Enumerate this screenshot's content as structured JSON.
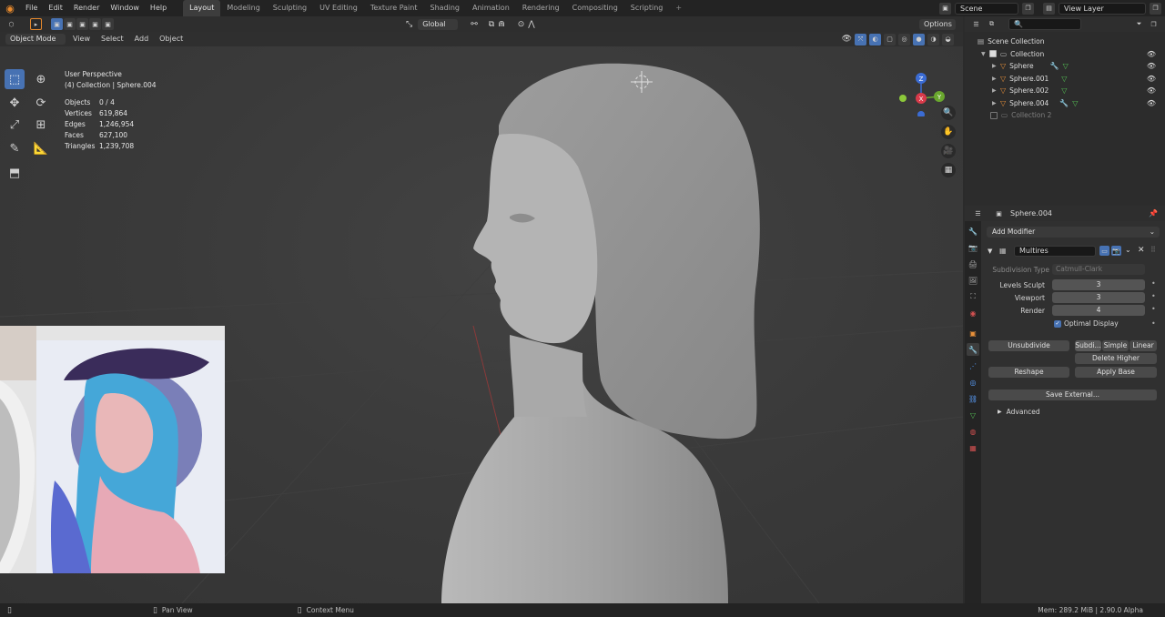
{
  "menu": [
    "File",
    "Edit",
    "Render",
    "Window",
    "Help"
  ],
  "workspaces": [
    "Layout",
    "Modeling",
    "Sculpting",
    "UV Editing",
    "Texture Paint",
    "Shading",
    "Animation",
    "Rendering",
    "Compositing",
    "Scripting"
  ],
  "workspace_active": "Layout",
  "scene": "Scene",
  "view_layer": "View Layer",
  "viewport": {
    "options": "Options",
    "orientation": "Global",
    "mode": "Object Mode",
    "menus": [
      "View",
      "Select",
      "Add",
      "Object"
    ],
    "perspective": "User Perspective",
    "collection_info": "(4) Collection | Sphere.004",
    "stats": [
      {
        "k": "Objects",
        "v": "0 / 4"
      },
      {
        "k": "Vertices",
        "v": "619,864"
      },
      {
        "k": "Edges",
        "v": "1,246,954"
      },
      {
        "k": "Faces",
        "v": "627,100"
      },
      {
        "k": "Triangles",
        "v": "1,239,708"
      }
    ],
    "gizmo": {
      "z": "Z",
      "y": "Y",
      "x": "X"
    }
  },
  "outliner": {
    "root": "Scene Collection",
    "collection": "Collection",
    "items": [
      "Sphere",
      "Sphere.001",
      "Sphere.002",
      "Sphere.004"
    ],
    "collection2": "Collection 2"
  },
  "properties": {
    "object": "Sphere.004",
    "add_modifier": "Add Modifier",
    "modifier_name": "Multires",
    "subdivision_type_label": "Subdivision Type",
    "subdivision_type": "Catmull-Clark",
    "levels_sculpt_label": "Levels Sculpt",
    "levels_sculpt": "3",
    "viewport_label": "Viewport",
    "viewport": "3",
    "render_label": "Render",
    "render": "4",
    "optimal_display": "Optimal Display",
    "unsubdivide": "Unsubdivide",
    "subdiv": "Subdi...",
    "simple": "Simple",
    "linear": "Linear",
    "delete_higher": "Delete Higher",
    "reshape": "Reshape",
    "apply_base": "Apply Base",
    "save_external": "Save External...",
    "advanced": "Advanced"
  },
  "status": {
    "pan": "Pan View",
    "context": "Context Menu",
    "mem": "Mem: 289.2 MiB | 2.90.0 Alpha"
  }
}
